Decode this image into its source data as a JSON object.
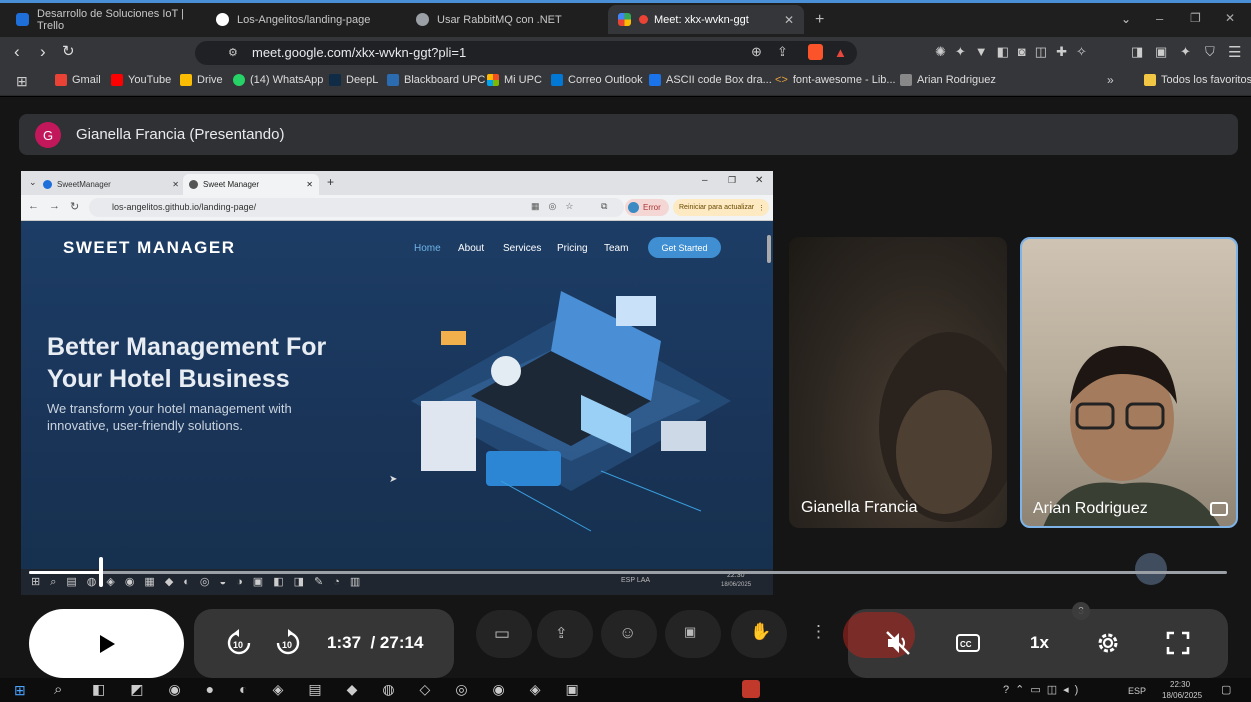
{
  "browser": {
    "tabs": [
      {
        "title": "Desarrollo de Soluciones IoT | Trello",
        "icon": "trello-icon",
        "color": "#1e6fd9"
      },
      {
        "title": "Los-Angelitos/landing-page",
        "icon": "github-icon",
        "color": "#ffffff"
      },
      {
        "title": "Usar RabbitMQ con .NET",
        "icon": "globe-icon",
        "color": "#9aa0a6"
      },
      {
        "title": "Meet: xkx-wvkn-ggt",
        "icon": "meet-icon",
        "color": "#34a853"
      }
    ],
    "url": "meet.google.com/xkx-wvkn-ggt?pli=1",
    "bookmarks": [
      {
        "label": "Gmail",
        "color": "#ea4335"
      },
      {
        "label": "YouTube",
        "color": "#ff0000"
      },
      {
        "label": "Drive",
        "color": "#fbbc04"
      },
      {
        "label": "(14) WhatsApp",
        "color": "#25d366"
      },
      {
        "label": "DeepL",
        "color": "#0f2b46"
      },
      {
        "label": "Blackboard UPC",
        "color": "#2b6cb0"
      },
      {
        "label": "Mi UPC",
        "color": "#f25022"
      },
      {
        "label": "Correo Outlook",
        "color": "#0078d4"
      },
      {
        "label": "ASCII code Box dra...",
        "color": "#1a73e8"
      },
      {
        "label": "font-awesome - Lib...",
        "color": "#e8a33d"
      },
      {
        "label": "Arian Rodriguez",
        "color": "#888888"
      }
    ],
    "all_bookmarks": "Todos los favoritos"
  },
  "meet": {
    "presenter_avatar": "G",
    "presenter_label": "Gianella Francia (Presentando)",
    "shared_screen": {
      "tabs": [
        "SweetManager",
        "Sweet Manager"
      ],
      "url": "los-angelitos.github.io/landing-page/",
      "error_label": "Error",
      "update_label": "Reiniciar para actualizar",
      "site": {
        "logo": "SWEET MANAGER",
        "nav": [
          "Home",
          "About",
          "Services",
          "Pricing",
          "Team"
        ],
        "cta": "Get Started",
        "headline_1": "Better Management For",
        "headline_2": "Your Hotel Business",
        "sub_1": "We transform your hotel management with",
        "sub_2": "innovative, user-friendly solutions."
      },
      "clock_time": "22:30",
      "clock_date": "18/06/2025",
      "lang": "ESP LAA"
    },
    "participants": [
      {
        "name": "Gianella Francia"
      },
      {
        "name": "Arian Rodriguez"
      }
    ]
  },
  "player": {
    "current_time": "1:37",
    "duration": "/ 27:14",
    "speed": "1x",
    "progress_fraction": 0.06
  },
  "windows": {
    "time": "22:30",
    "date": "18/06/2025",
    "lang": "ESP"
  }
}
